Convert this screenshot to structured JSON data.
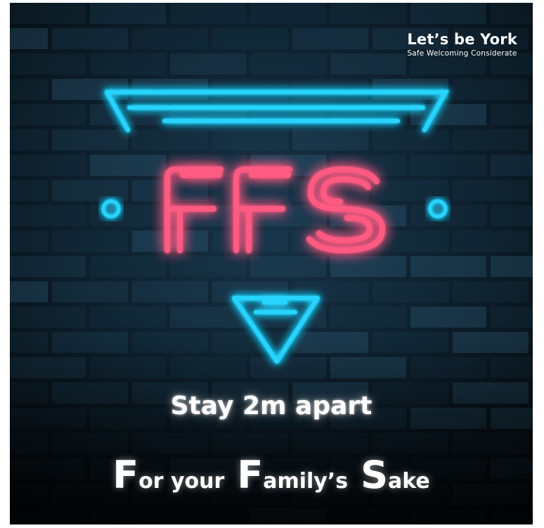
{
  "brand": {
    "title": "Let’s be York",
    "subtitle": "Safe  Welcoming  Considerate"
  },
  "sign": {
    "text": "FFS",
    "pink": "#ff4d79",
    "blue": "#1fd3ff"
  },
  "tagline": "Stay 2m apart",
  "expansion": {
    "words": [
      {
        "cap": "F",
        "rest": "or your"
      },
      {
        "cap": "F",
        "rest": "amily’s"
      },
      {
        "cap": "S",
        "rest": "ake"
      }
    ]
  }
}
